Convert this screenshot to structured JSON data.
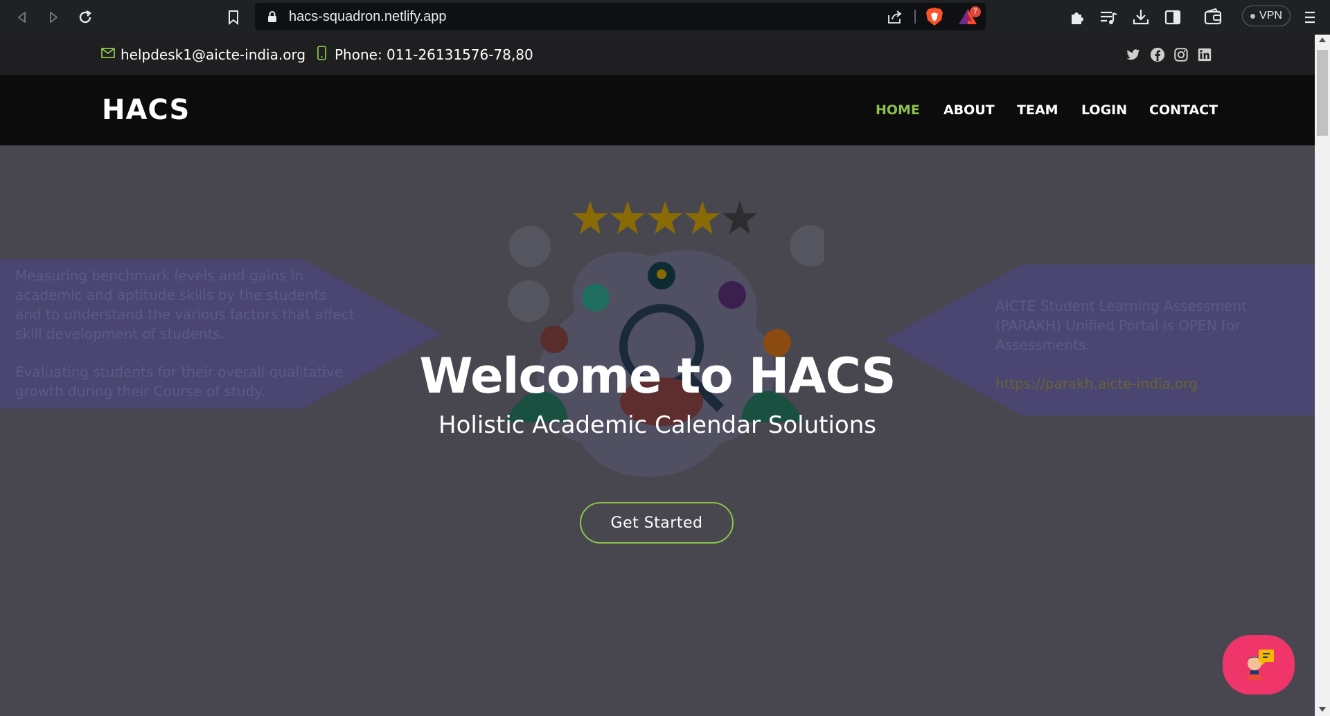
{
  "browser": {
    "url": "hacs-squadron.netlify.app",
    "bat_badge": "7",
    "vpn_label": "VPN",
    "icons": [
      "back-icon",
      "forward-icon",
      "reload-icon",
      "bookmark-icon",
      "lock-icon",
      "share-icon",
      "brave-shield-icon",
      "brave-rewards-icon",
      "extensions-icon",
      "playlist-icon",
      "download-icon",
      "sidebar-icon",
      "wallet-icon",
      "menu-icon"
    ]
  },
  "topbar": {
    "email": "helpdesk1@aicte-india.org",
    "phone": "Phone: 011-26131576-78,80",
    "social": [
      "twitter-icon",
      "facebook-icon",
      "instagram-icon",
      "linkedin-icon"
    ]
  },
  "header": {
    "logo": "HACS",
    "nav": [
      {
        "label": "HOME",
        "active": true
      },
      {
        "label": "ABOUT",
        "active": false
      },
      {
        "label": "TEAM",
        "active": false
      },
      {
        "label": "LOGIN",
        "active": false
      },
      {
        "label": "CONTACT",
        "active": false
      }
    ]
  },
  "hero": {
    "title": "Welcome to HACS",
    "subtitle": "Holistic Academic Calendar Solutions",
    "cta_label": "Get Started",
    "left_banner": [
      "Measuring benchmark levels and gains in academic and aptitude skills by the students and to understand the various factors that affect skill development of students.",
      "Evaluating students for their overall qualitative growth during their Course of study."
    ],
    "right_banner": {
      "text": "AICTE Student Learning Assessment (PARAKH) Unified Portal is OPEN for Assessments.",
      "link": "https://parakh.aicte-india.org"
    },
    "rating": {
      "value": 4,
      "max": 5
    }
  },
  "colors": {
    "accent": "#8bc34a",
    "hero_bg": "#48474f",
    "banner": "#4b4571",
    "chat": "#f0356b"
  }
}
